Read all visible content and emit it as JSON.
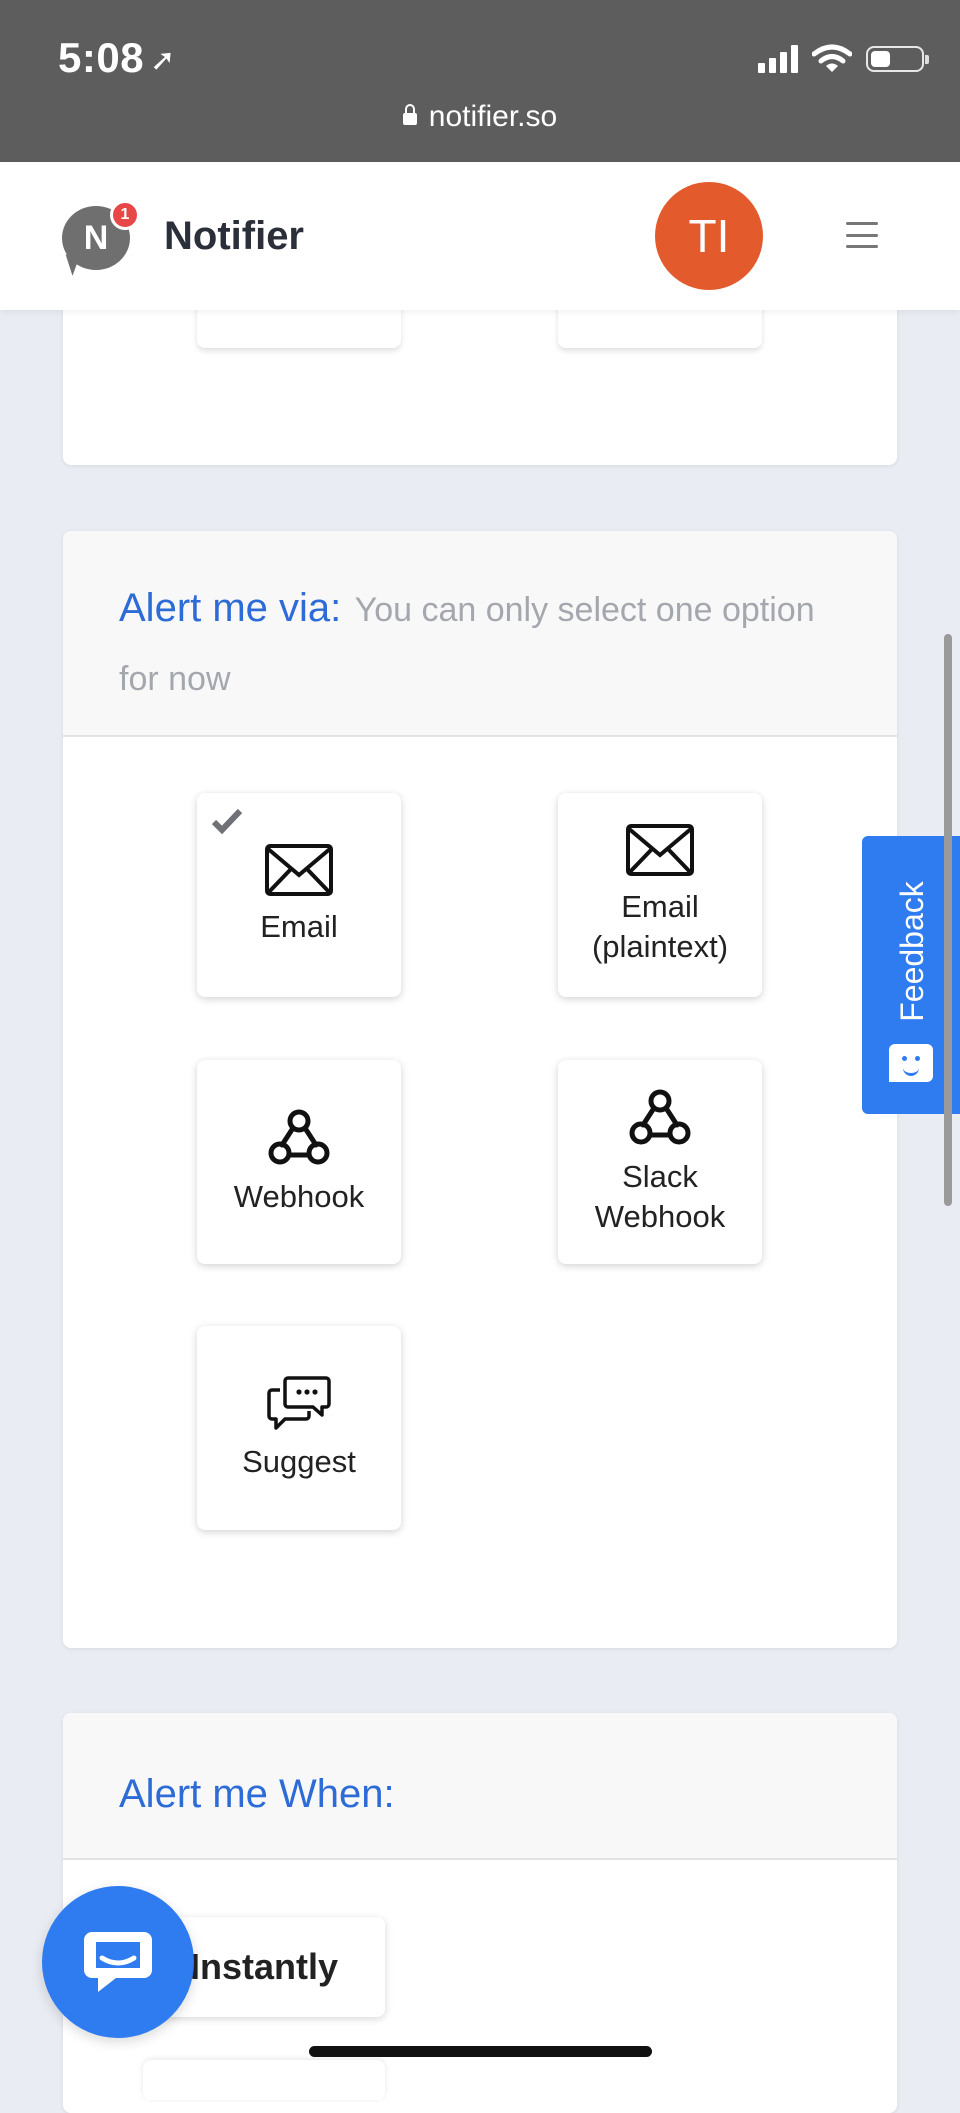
{
  "status_bar": {
    "time": "5:08",
    "url": "notifier.so",
    "battery_level": 0.4
  },
  "header": {
    "brand": "Notifier",
    "logo_letter": "N",
    "notification_count": "1",
    "avatar_initials": "TI",
    "avatar_color": "#e35a2c"
  },
  "alert_via": {
    "title": "Alert me via:",
    "hint": "You can only select one option for now",
    "options": [
      {
        "label_lines": [
          "Email"
        ],
        "icon": "envelope-icon",
        "selected": true
      },
      {
        "label_lines": [
          "Email",
          "(plaintext)"
        ],
        "icon": "envelope-icon",
        "selected": false
      },
      {
        "label_lines": [
          "Webhook"
        ],
        "icon": "webhook-icon",
        "selected": false
      },
      {
        "label_lines": [
          "Slack",
          "Webhook"
        ],
        "icon": "webhook-icon",
        "selected": false
      },
      {
        "label_lines": [
          "Suggest"
        ],
        "icon": "chat-bubbles-icon",
        "selected": false
      }
    ]
  },
  "alert_when": {
    "title": "Alert me When:",
    "options": [
      {
        "label": "Instantly"
      }
    ]
  },
  "feedback": {
    "label": "Feedback"
  },
  "colors": {
    "accent": "#2d6bd6",
    "feedback_bg": "#2f7bf0",
    "badge": "#e84747"
  }
}
